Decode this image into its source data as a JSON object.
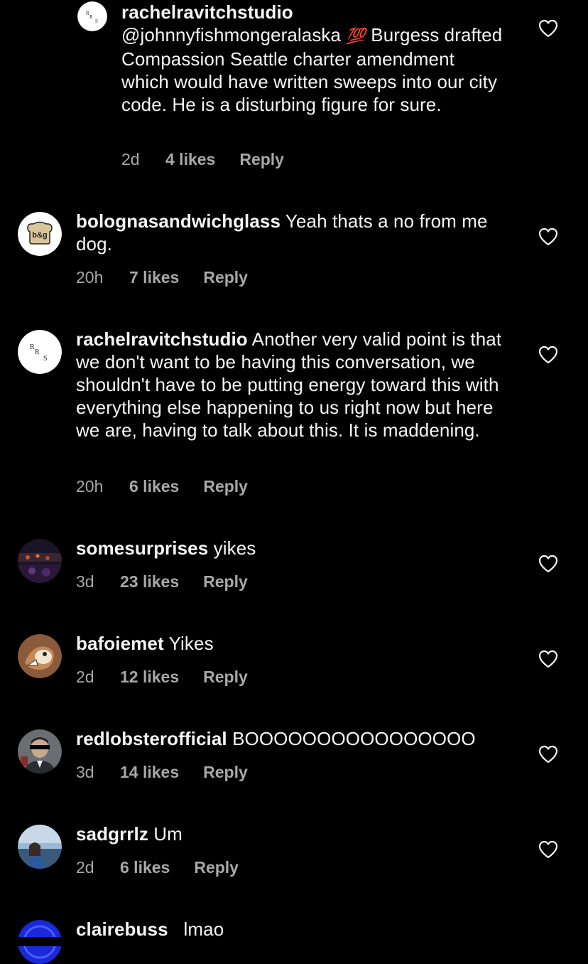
{
  "comments": [
    {
      "username": "rachelravitchstudio",
      "mention": "@johnnyfishmongeralaska",
      "emoji": "💯",
      "text": "Burgess drafted Compassion Seattle charter amendment which would have written sweeps into our city code. He is a disturbing figure for sure.",
      "time": "2d",
      "likes": "4 likes",
      "reply": "Reply",
      "avatar": "rrs-logo-icon"
    },
    {
      "username": "bolognasandwichglass",
      "text": "Yeah thats a no from me dog.",
      "time": "20h",
      "likes": "7 likes",
      "reply": "Reply",
      "avatar": "bsg-toast-logo-icon",
      "avatar_text": "b&g"
    },
    {
      "username": "rachelravitchstudio",
      "text": "Another very valid point is that we don't want to be having this conversation, we shouldn't have to be putting energy toward this with everything else happening to us right now but here we are, having to talk about this. It is maddening.",
      "time": "20h",
      "likes": "6 likes",
      "reply": "Reply",
      "avatar": "rrs-logo-icon"
    },
    {
      "username": "somesurprises",
      "text": "yikes",
      "time": "3d",
      "likes": "23 likes",
      "reply": "Reply",
      "avatar": "concert-photo-avatar"
    },
    {
      "username": "bafoiemet",
      "text": "Yikes",
      "time": "2d",
      "likes": "12 likes",
      "reply": "Reply",
      "avatar": "cartoon-dog-avatar"
    },
    {
      "username": "redlobsterofficial",
      "text": "BOOOOOOOOOOOOOOOO",
      "time": "3d",
      "likes": "14 likes",
      "reply": "Reply",
      "avatar": "man-portrait-avatar"
    },
    {
      "username": "sadgrrlz",
      "text": "Um",
      "time": "2d",
      "likes": "6 likes",
      "reply": "Reply",
      "avatar": "person-photo-avatar"
    },
    {
      "username": "clairebuss_",
      "text": "lmao",
      "avatar": "blue-circle-avatar"
    }
  ],
  "colors": {
    "background": "#000000",
    "text": "#f5f5f5",
    "meta": "#a8a8a8",
    "emoji_red": "#e0245e"
  }
}
